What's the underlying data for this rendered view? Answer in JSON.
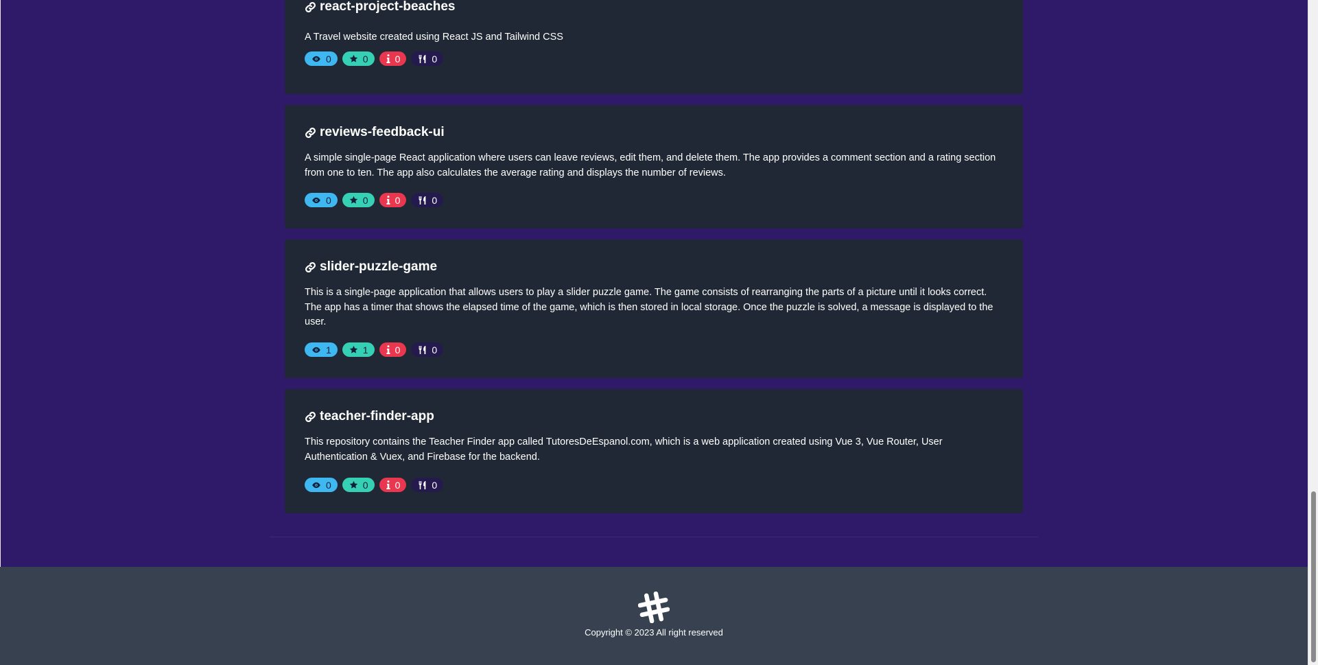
{
  "repos": [
    {
      "name": "react-project-beaches",
      "description": "A Travel website created using React JS and Tailwind CSS",
      "watchers": "0",
      "stars": "0",
      "issues": "0",
      "forks": "0"
    },
    {
      "name": "reviews-feedback-ui",
      "description": "A simple single-page React application where users can leave reviews, edit them, and delete them. The app provides a comment section and a rating section from one to ten. The app also calculates the average rating and displays the number of reviews.",
      "watchers": "0",
      "stars": "0",
      "issues": "0",
      "forks": "0"
    },
    {
      "name": "slider-puzzle-game",
      "description": "This is a single-page application that allows users to play a slider puzzle game. The game consists of rearranging the parts of a picture until it looks correct. The app has a timer that shows the elapsed time of the game, which is then stored in local storage. Once the puzzle is solved, a message is displayed to the user.",
      "watchers": "1",
      "stars": "1",
      "issues": "0",
      "forks": "0"
    },
    {
      "name": "teacher-finder-app",
      "description": "This repository contains the Teacher Finder app called TutoresDeEspanol.com, which is a web application created using Vue 3, Vue Router, User Authentication & Vuex, and Firebase for the backend.",
      "watchers": "0",
      "stars": "0",
      "issues": "0",
      "forks": "0"
    }
  ],
  "footer": {
    "copyright": "Copyright © 2023 All right reserved",
    "logo_icon": "hashtag-icon"
  },
  "icons": {
    "repo_link": "link-icon",
    "watchers": "eye-icon",
    "stars": "star-icon",
    "issues": "info-icon",
    "forks": "fork-knife-icon"
  },
  "colors": {
    "page_background": "#2e1a68",
    "card_background": "#1f2834",
    "footer_background": "#374150",
    "watch_badge": "#3fb7f0",
    "star_badge": "#36d0b5",
    "issue_badge": "#e8374f",
    "fork_badge": "#251a4e"
  }
}
